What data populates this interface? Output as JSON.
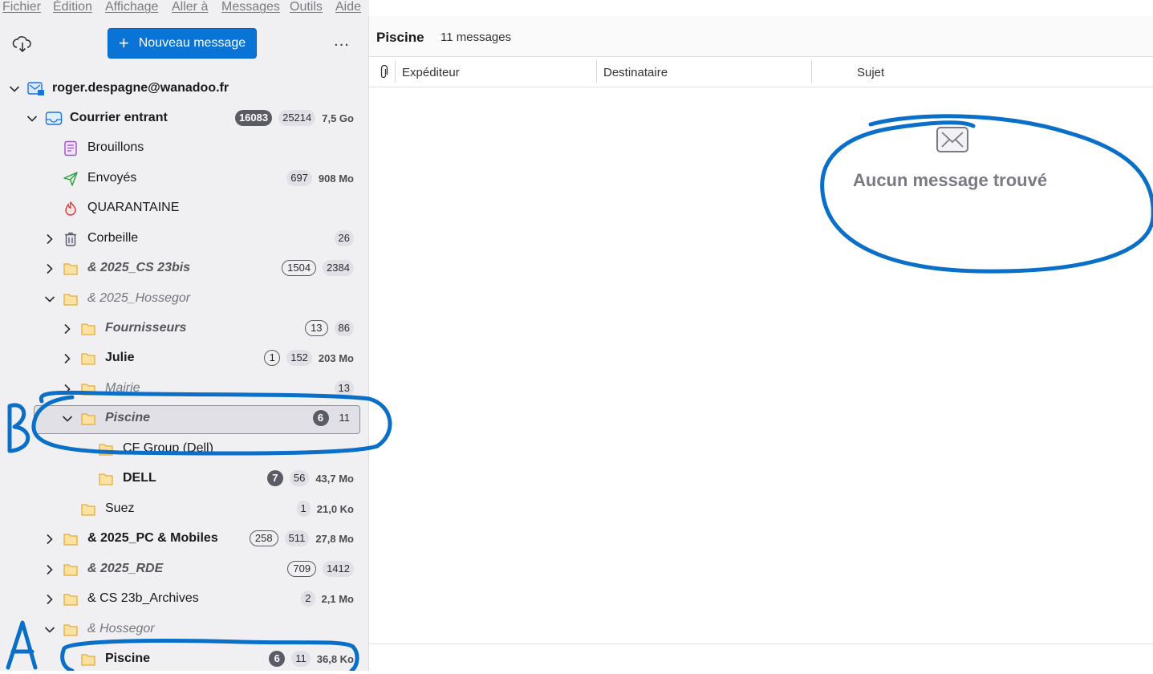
{
  "menubar": [
    "Fichier",
    "Édition",
    "Affichage",
    "Aller à",
    "Messages",
    "Outils",
    "Aide"
  ],
  "toolbar": {
    "new_message": "Nouveau message",
    "more": "..."
  },
  "account": "roger.despagne@wanadoo.fr",
  "folders": [
    {
      "name": "Courrier entrant",
      "unread": "16083",
      "total": "25214",
      "size": "7,5 Go"
    },
    {
      "name": "Brouillons"
    },
    {
      "name": "Envoyés",
      "total": "697",
      "size": "908 Mo"
    },
    {
      "name": "QUARANTAINE"
    },
    {
      "name": "Corbeille",
      "total": "26"
    },
    {
      "name": "& 2025_CS 23bis",
      "unread": "1504",
      "total": "2384"
    },
    {
      "name": "& 2025_Hossegor"
    },
    {
      "name": "Fournisseurs",
      "unread": "13",
      "total": "86"
    },
    {
      "name": "Julie",
      "unread": "1",
      "total": "152",
      "size": "203 Mo"
    },
    {
      "name": "Mairie",
      "total": "13"
    },
    {
      "name": "Piscine",
      "unread": "6",
      "total": "11"
    },
    {
      "name": "CF Group (Dell)"
    },
    {
      "name": "DELL",
      "unread": "7",
      "total": "56",
      "size": "43,7 Mo"
    },
    {
      "name": "Suez",
      "total": "1",
      "size": "21,0 Ko"
    },
    {
      "name": "& 2025_PC & Mobiles",
      "unread": "258",
      "total": "511",
      "size": "27,8 Mo"
    },
    {
      "name": "& 2025_RDE",
      "unread": "709",
      "total": "1412"
    },
    {
      "name": "& CS 23b_Archives",
      "total": "2",
      "size": "2,1 Mo"
    },
    {
      "name": "& Hossegor"
    },
    {
      "name": "Piscine",
      "unread": "6",
      "total": "11",
      "size": "36,8 Ko"
    }
  ],
  "message_list": {
    "folder_title": "Piscine",
    "count": "11 messages",
    "columns": [
      "Expéditeur",
      "Destinataire",
      "Sujet"
    ],
    "empty_text": "Aucun message trouvé"
  },
  "annotations": {
    "a": "A",
    "b": "B"
  },
  "colors": {
    "accent": "#0a74d6",
    "annotation": "#0a6fc8",
    "folder": "#f1c25c"
  }
}
